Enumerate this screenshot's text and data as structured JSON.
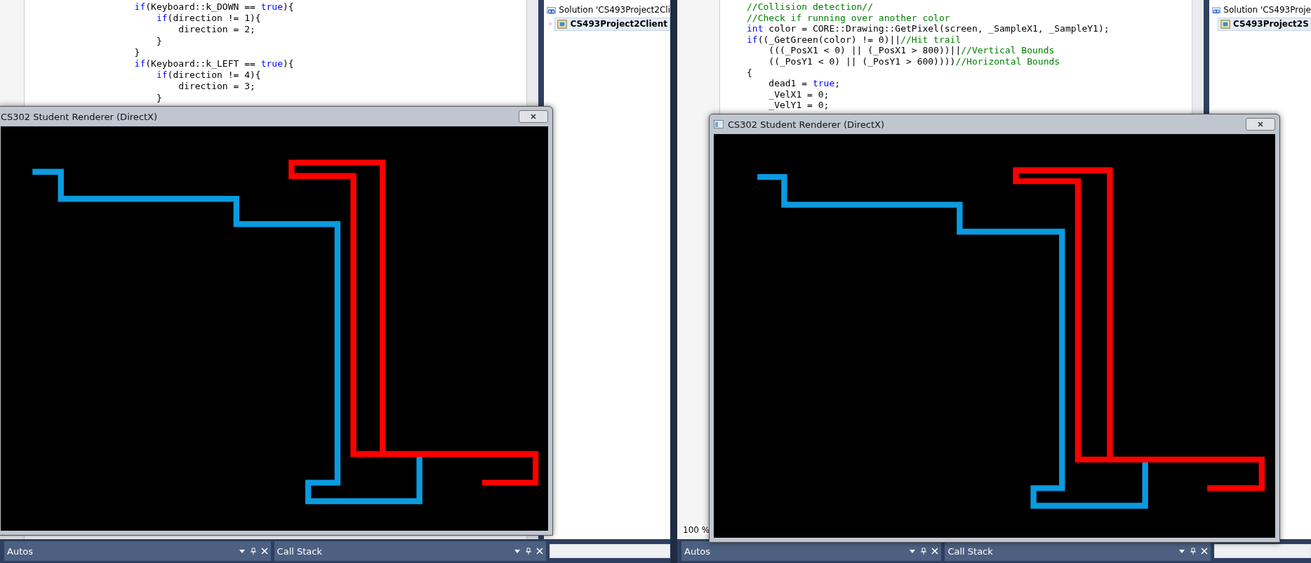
{
  "panes": [
    {
      "editor": {
        "lines": [
          [
            {
              "kind": "keyword",
              "text": "        if"
            },
            {
              "kind": "plain",
              "text": "(Keyboard::k_DOWN == "
            },
            {
              "kind": "keyword",
              "text": "true"
            },
            {
              "kind": "plain",
              "text": "){"
            }
          ],
          [
            {
              "kind": "keyword",
              "text": "            if"
            },
            {
              "kind": "plain",
              "text": "(direction != 1){"
            }
          ],
          [
            {
              "kind": "plain",
              "text": "                direction = 2;"
            }
          ],
          [
            {
              "kind": "plain",
              "text": "            }"
            }
          ],
          [
            {
              "kind": "plain",
              "text": "        }"
            }
          ],
          [
            {
              "kind": "keyword",
              "text": "        if"
            },
            {
              "kind": "plain",
              "text": "(Keyboard::k_LEFT == "
            },
            {
              "kind": "keyword",
              "text": "true"
            },
            {
              "kind": "plain",
              "text": "){"
            }
          ],
          [
            {
              "kind": "keyword",
              "text": "            if"
            },
            {
              "kind": "plain",
              "text": "(direction != 4){"
            }
          ],
          [
            {
              "kind": "plain",
              "text": "                direction = 3;"
            }
          ],
          [
            {
              "kind": "plain",
              "text": "            }"
            }
          ]
        ]
      },
      "solution": {
        "title": "Solution 'CS493Project2Cli",
        "project": {
          "label": "CS493Project2Client",
          "selected": true
        }
      },
      "game_window": {
        "title": "CS302 Student Renderer (DirectX)"
      },
      "panels": [
        "Autos",
        "Call Stack"
      ]
    },
    {
      "editor": {
        "zoom": "100 %",
        "lines": [
          [
            {
              "kind": "comment",
              "text": "//Collision detection//"
            }
          ],
          [
            {
              "kind": "comment",
              "text": "//Check if running over another color"
            }
          ],
          [
            {
              "kind": "keyword",
              "text": "int"
            },
            {
              "kind": "plain",
              "text": " color = CORE::Drawing::GetPixel(screen, _SampleX1, _SampleY1);"
            }
          ],
          [
            {
              "kind": "keyword",
              "text": "if"
            },
            {
              "kind": "plain",
              "text": "((_GetGreen(color) != 0)||"
            },
            {
              "kind": "comment",
              "text": "//Hit trail"
            }
          ],
          [
            {
              "kind": "plain",
              "text": "    (((_PosX1 < 0) || (_PosX1 > 800))||"
            },
            {
              "kind": "comment",
              "text": "//Vertical Bounds"
            }
          ],
          [
            {
              "kind": "plain",
              "text": "    ((_PosY1 < 0) || (_PosY1 > 600))))"
            },
            {
              "kind": "comment",
              "text": "//Horizontal Bounds"
            }
          ],
          [
            {
              "kind": "plain",
              "text": "{"
            }
          ],
          [
            {
              "kind": "plain",
              "text": "    dead1 = "
            },
            {
              "kind": "keyword",
              "text": "true"
            },
            {
              "kind": "plain",
              "text": ";"
            }
          ],
          [
            {
              "kind": "plain",
              "text": "    _VelX1 = 0;"
            }
          ],
          [
            {
              "kind": "plain",
              "text": "    _VelY1 = 0;"
            }
          ]
        ]
      },
      "solution": {
        "title": "Solution 'CS493Proje",
        "project": {
          "label": "CS493Project2S",
          "selected": true
        }
      },
      "game_window": {
        "title": "CS302 Student Renderer (DirectX)"
      },
      "panels": [
        "Autos",
        "Call Stack"
      ]
    }
  ]
}
